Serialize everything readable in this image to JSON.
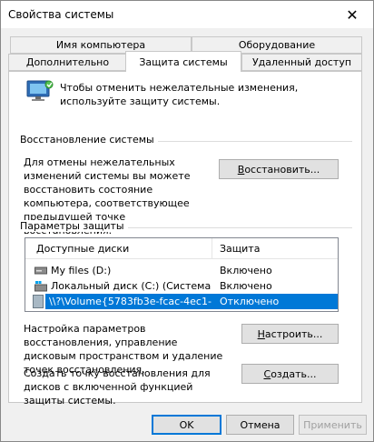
{
  "window": {
    "title": "Свойства системы",
    "close_glyph": "✕"
  },
  "tabs": {
    "row1": [
      {
        "label": "Имя компьютера"
      },
      {
        "label": "Оборудование"
      }
    ],
    "row2": [
      {
        "label": "Дополнительно"
      },
      {
        "label": "Защита системы",
        "active": true
      },
      {
        "label": "Удаленный доступ"
      }
    ]
  },
  "info": {
    "icon": "system-protection-icon",
    "text": "Чтобы отменить нежелательные изменения, используйте защиту системы."
  },
  "restore": {
    "group_label": "Восстановление системы",
    "description": "Для отмены нежелательных изменений системы вы можете восстановить состояние компьютера, соответствующее предыдущей точке восстановления.",
    "button_label": "Восстановить...",
    "button_accel": "В",
    "button_rest": "осстановить..."
  },
  "protection": {
    "group_label": "Параметры защиты",
    "columns": [
      "Доступные диски",
      "Защита"
    ],
    "drives": [
      {
        "name": "My files (D:)",
        "status": "Включено",
        "icon": "drive-icon",
        "selected": false
      },
      {
        "name": "Локальный диск (C:) (Система)",
        "status": "Включено",
        "icon": "system-drive-icon",
        "selected": false
      },
      {
        "name": "\\\\?\\Volume{5783fb3e-fcac-4ec1-a...",
        "status": "Отключено",
        "icon": "volume-icon",
        "selected": true
      }
    ]
  },
  "configure": {
    "description": "Настройка параметров восстановления, управление дисковым пространством и удаление точек восстановления.",
    "button_accel": "Н",
    "button_rest": "астроить..."
  },
  "create": {
    "description": "Создать точку восстановления для дисков с включенной функцией защиты системы.",
    "button_accel": "С",
    "button_rest": "оздать..."
  },
  "footer": {
    "ok": "OK",
    "cancel": "Отмена",
    "apply": "Применить"
  },
  "colors": {
    "accent": "#0078d7"
  }
}
